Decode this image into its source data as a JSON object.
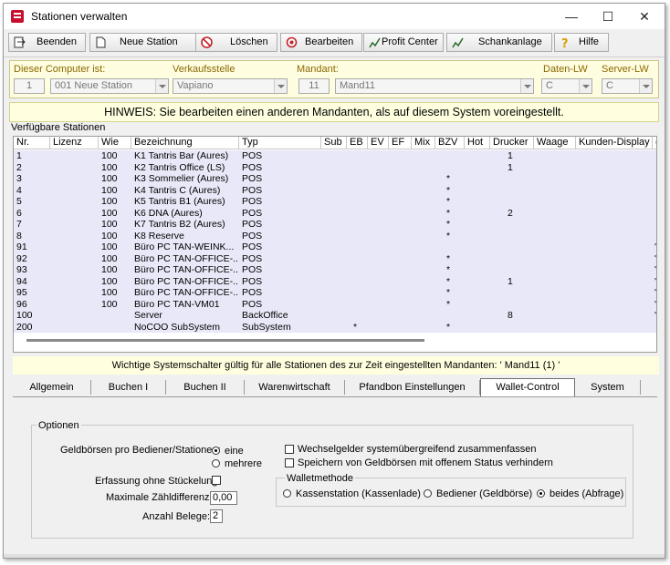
{
  "window": {
    "title": "Stationen verwalten"
  },
  "toolbar": {
    "buttons": [
      {
        "label": "Beenden",
        "icon": "exit-icon"
      },
      {
        "label": "Neue Station",
        "icon": "new-document-icon"
      },
      {
        "label": "Löschen",
        "icon": "delete-icon"
      },
      {
        "label": "Bearbeiten",
        "icon": "edit-icon"
      },
      {
        "label": "Profit Center",
        "icon": "profit-center-icon"
      },
      {
        "label": "Schankanlage",
        "icon": "tap-system-icon"
      },
      {
        "label": "Hilfe",
        "icon": "help-icon"
      }
    ]
  },
  "header": {
    "computer_label": "Dieser Computer ist:",
    "computer_no": "1",
    "computer_name": "001  Neue Station",
    "verkaufsstelle_label": "Verkaufsstelle",
    "verkaufsstelle_value": "Vapiano",
    "mandant_label": "Mandant:",
    "mandant_no": "11",
    "mandant_value": "Mand11",
    "daten_lw_label": "Daten-LW",
    "daten_lw_value": "C",
    "server_lw_label": "Server-LW",
    "server_lw_value": "C"
  },
  "hint": "HINWEIS: Sie bearbeiten einen anderen Mandanten, als auf diesem System voreingestellt.",
  "stations": {
    "group_title": "Verfügbare Stationen",
    "columns": [
      "Nr.",
      "Lizenz",
      "Wie",
      "Bezeichnung",
      "Typ",
      "Sub",
      "EB",
      "EV",
      "EF",
      "Mix",
      "BZV",
      "Hot",
      "Drucker",
      "Waage",
      "Kunden-Display",
      "("
    ],
    "rows": [
      {
        "nr": "1",
        "wie": "100",
        "bez": "K1 Tantris Bar (Aures)",
        "typ": "POS",
        "eb": "",
        "bzv": "",
        "drucker": "1",
        "mark": ""
      },
      {
        "nr": "2",
        "wie": "100",
        "bez": "K2 Tantris Office (LS)",
        "typ": "POS",
        "eb": "",
        "bzv": "",
        "drucker": "1",
        "mark": ""
      },
      {
        "nr": "3",
        "wie": "100",
        "bez": "K3 Sommelier (Aures)",
        "typ": "POS",
        "eb": "",
        "bzv": "*",
        "drucker": "",
        "mark": ""
      },
      {
        "nr": "4",
        "wie": "100",
        "bez": "K4 Tantris C (Aures)",
        "typ": "POS",
        "eb": "",
        "bzv": "*",
        "drucker": "",
        "mark": ""
      },
      {
        "nr": "5",
        "wie": "100",
        "bez": "K5 Tantris B1 (Aures)",
        "typ": "POS",
        "eb": "",
        "bzv": "*",
        "drucker": "",
        "mark": ""
      },
      {
        "nr": "6",
        "wie": "100",
        "bez": "K6 DNA (Aures)",
        "typ": "POS",
        "eb": "",
        "bzv": "*",
        "drucker": "2",
        "mark": ""
      },
      {
        "nr": "7",
        "wie": "100",
        "bez": "K7 Tantris B2 (Aures)",
        "typ": "POS",
        "eb": "",
        "bzv": "*",
        "drucker": "",
        "mark": ""
      },
      {
        "nr": "8",
        "wie": "100",
        "bez": "K8 Reserve",
        "typ": "POS",
        "eb": "",
        "bzv": "*",
        "drucker": "",
        "mark": ""
      },
      {
        "nr": "91",
        "wie": "100",
        "bez": "Büro PC TAN-WEINK...",
        "typ": "POS",
        "eb": "",
        "bzv": "",
        "drucker": "",
        "mark": "'"
      },
      {
        "nr": "92",
        "wie": "100",
        "bez": "Büro PC TAN-OFFICE-...",
        "typ": "POS",
        "eb": "",
        "bzv": "*",
        "drucker": "",
        "mark": "'"
      },
      {
        "nr": "93",
        "wie": "100",
        "bez": "Büro PC TAN-OFFICE-...",
        "typ": "POS",
        "eb": "",
        "bzv": "*",
        "drucker": "",
        "mark": "'"
      },
      {
        "nr": "94",
        "wie": "100",
        "bez": "Büro PC TAN-OFFICE-...",
        "typ": "POS",
        "eb": "",
        "bzv": "*",
        "drucker": "1",
        "mark": "'"
      },
      {
        "nr": "95",
        "wie": "100",
        "bez": "Büro PC TAN-OFFICE-...",
        "typ": "POS",
        "eb": "",
        "bzv": "*",
        "drucker": "",
        "mark": "'"
      },
      {
        "nr": "96",
        "wie": "100",
        "bez": "Büro PC TAN-VM01",
        "typ": "POS",
        "eb": "",
        "bzv": "*",
        "drucker": "",
        "mark": "'"
      },
      {
        "nr": "100",
        "wie": "",
        "bez": "Server",
        "typ": "BackOffice",
        "eb": "",
        "bzv": "",
        "drucker": "8",
        "mark": "'"
      },
      {
        "nr": "200",
        "wie": "",
        "bez": "NoCOO SubSystem",
        "typ": "SubSystem",
        "eb": "*",
        "bzv": "*",
        "drucker": "",
        "mark": ""
      }
    ]
  },
  "note": "Wichtige Systemschalter gültig für alle Stationen des zur Zeit eingestellten Mandanten: ' Mand11 (1) '",
  "tabs": [
    "Allgemein",
    "Buchen I",
    "Buchen II",
    "Warenwirtschaft",
    "Pfandbon Einstellungen",
    "Wallet-Control",
    "System"
  ],
  "active_tab": "Wallet-Control",
  "options": {
    "group_title": "Optionen",
    "geldboersen_label": "Geldbörsen pro Bediener/Stationen:",
    "eine": "eine",
    "mehrere": "mehrere",
    "erfassung_label": "Erfassung ohne Stückelung",
    "max_label": "Maximale Zähldifferenz:",
    "max_value": "0,00",
    "belege_label": "Anzahl Belege:",
    "belege_value": "2",
    "wechsel_label": "Wechselgelder systemübergreifend zusammenfassen",
    "speichern_label": "Speichern von Geldbörsen mit offenem Status verhindern",
    "walletmethode_title": "Walletmethode",
    "kassenstation": "Kassenstation (Kassenlade)",
    "bediener": "Bediener (Geldbörse)",
    "beides": "beides (Abfrage)"
  }
}
